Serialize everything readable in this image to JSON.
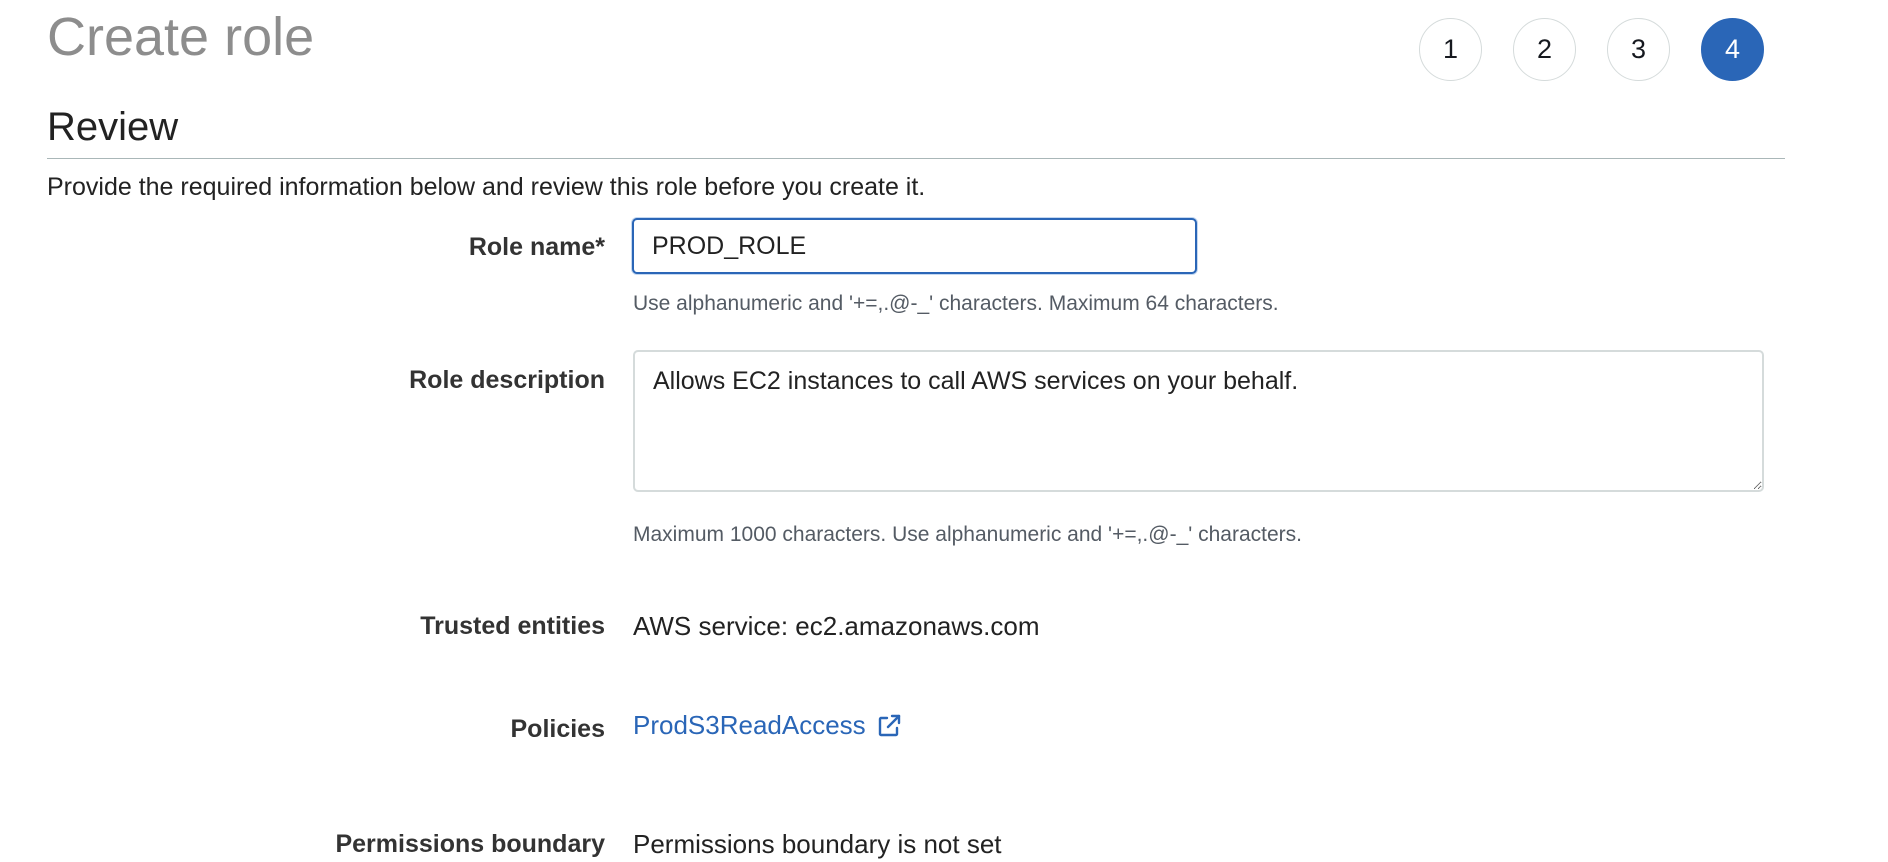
{
  "header": {
    "title": "Create role"
  },
  "steps": [
    {
      "label": "1",
      "active": false
    },
    {
      "label": "2",
      "active": false
    },
    {
      "label": "3",
      "active": false
    },
    {
      "label": "4",
      "active": true
    }
  ],
  "section": {
    "title": "Review",
    "intro": "Provide the required information below and review this role before you create it."
  },
  "form": {
    "role_name": {
      "label": "Role name*",
      "value": "PROD_ROLE",
      "hint": "Use alphanumeric and '+=,.@-_' characters. Maximum 64 characters."
    },
    "role_description": {
      "label": "Role description",
      "value": "Allows EC2 instances to call AWS services on your behalf.",
      "hint": "Maximum 1000 characters. Use alphanumeric and '+=,.@-_' characters."
    },
    "trusted_entities": {
      "label": "Trusted entities",
      "value": "AWS service: ec2.amazonaws.com"
    },
    "policies": {
      "label": "Policies",
      "link_text": "ProdS3ReadAccess",
      "icon": "external-link-icon"
    },
    "permissions_boundary": {
      "label": "Permissions boundary",
      "value": "Permissions boundary is not set"
    }
  },
  "colors": {
    "accent": "#2a66b7",
    "muted_title": "#8d8d8d",
    "hint": "#545b64"
  }
}
